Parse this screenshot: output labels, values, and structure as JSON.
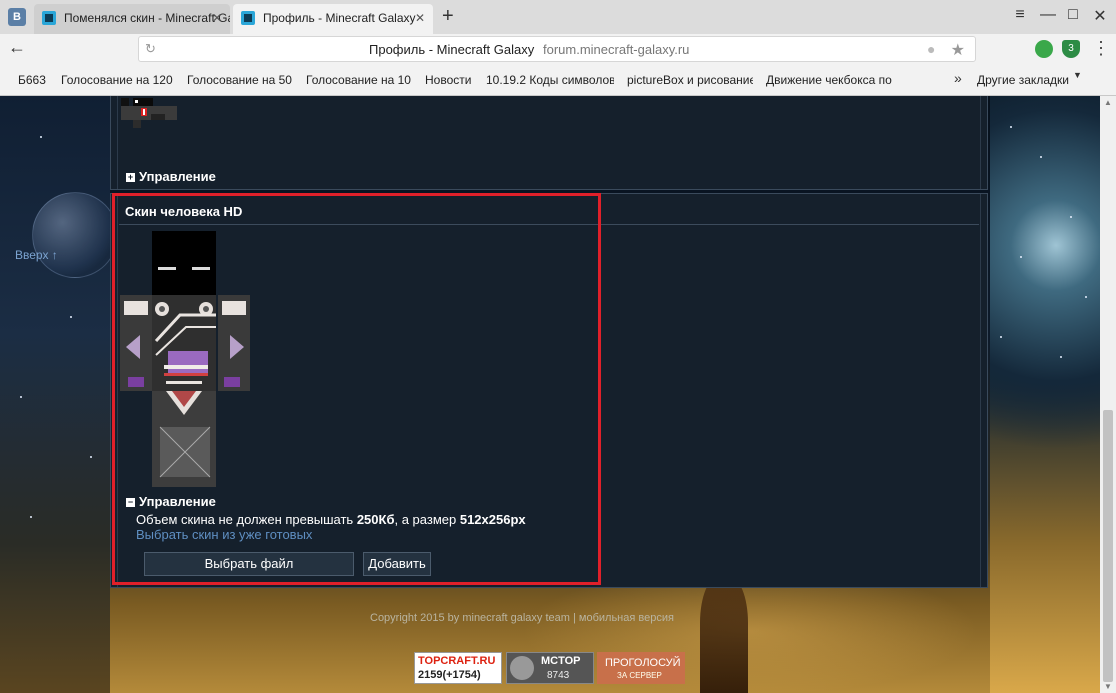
{
  "browser": {
    "vk_badge": "B",
    "tabs": [
      {
        "label": "Поменялся скин - Minecraft Ga"
      },
      {
        "label": "Профиль - Minecraft Galaxy"
      }
    ],
    "new_tab": "+",
    "window_controls": {
      "menu": "≡",
      "minimize": "—",
      "maximize": "□",
      "close": "✕"
    },
    "back": "←",
    "omnibox": {
      "title": "Профиль - Minecraft Galaxy",
      "url": "forum.minecraft-galaxy.ru"
    },
    "extension_badge": "3",
    "bookmarks": [
      "Б663",
      "Голосование на 120",
      "Голосование на 50",
      "Голосование на 10",
      "Новости",
      "10.19.2 Коды символов",
      "pictureBox и рисование",
      "Движение чекбокса по"
    ],
    "bookmarks_more": "»",
    "other_bookmarks": "Другие закладки"
  },
  "page": {
    "up_link": "Вверх ↑",
    "top_panel": {
      "management": "Управление",
      "toggle": "+"
    },
    "hd_panel": {
      "title": "Скин человека HD",
      "management": "Управление",
      "toggle": "−",
      "note_prefix": "Объем скина не должен превышать ",
      "note_size": "250Кб",
      "note_mid": ", а размер ",
      "note_dims": "512x256px",
      "choose_link": "Выбрать скин из уже готовых",
      "choose_file_button": "Выбрать файл",
      "add_button": "Добавить"
    },
    "footer": "Copyright 2015 by minecraft galaxy team | мобильная версия",
    "banners": {
      "topcraft": {
        "name": "TOPCRAFT.RU",
        "stat": "2159(+1754)"
      },
      "mctop": {
        "name": "MCTOP",
        "stat": "8743"
      },
      "vote": {
        "line1": "ПРОГОЛОСУЙ",
        "line2": "ЗА СЕРВЕР"
      }
    }
  },
  "colors": {
    "accent_link": "#5f8fc2",
    "panel_bg": "#15202c",
    "highlight": "#e0202a"
  }
}
